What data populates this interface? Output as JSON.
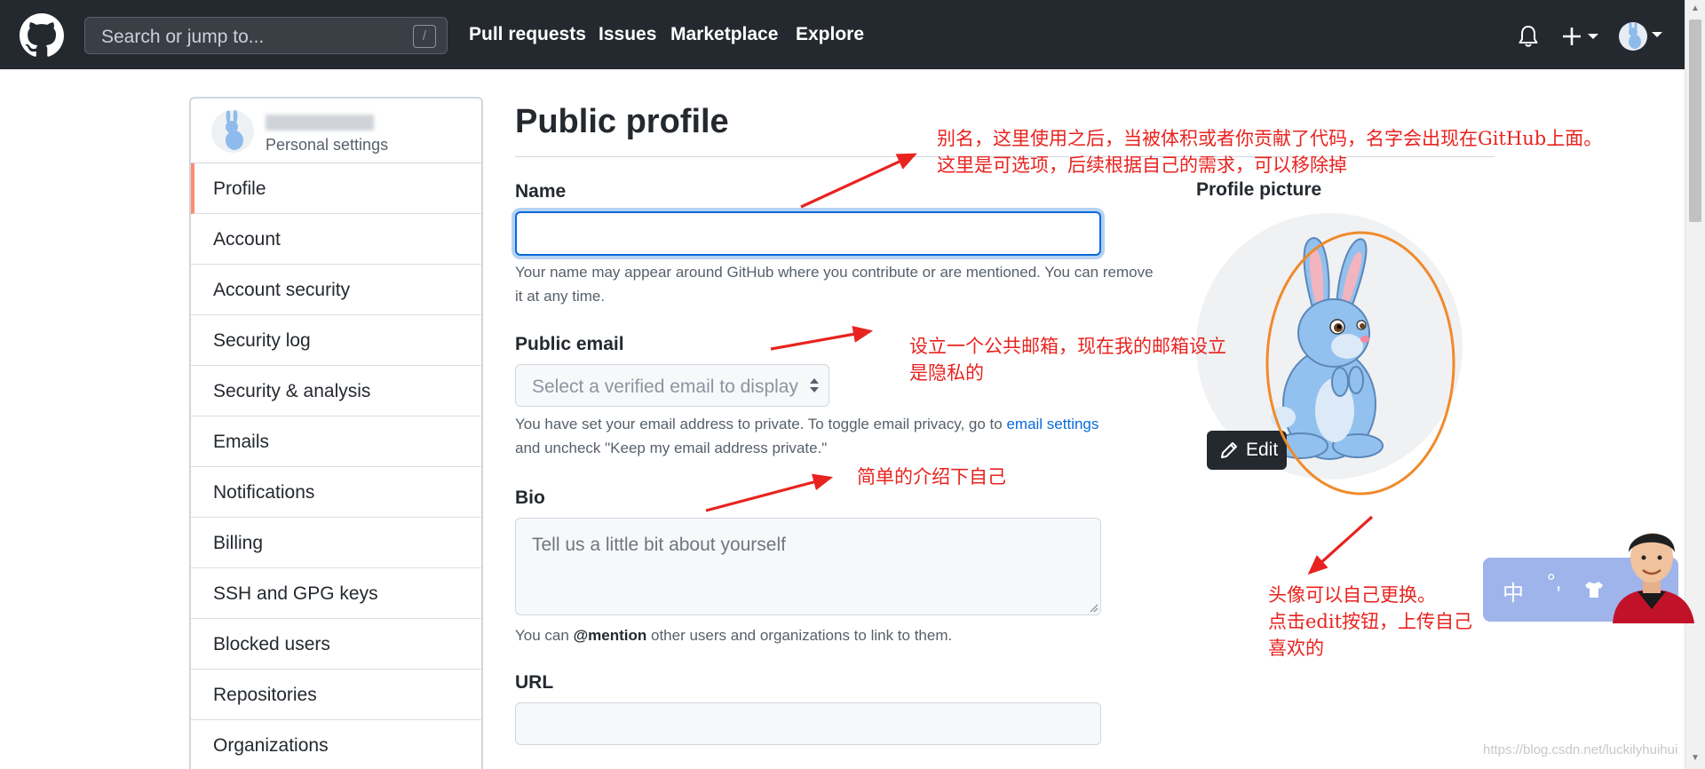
{
  "header": {
    "search_placeholder": "Search or jump to...",
    "search_shortcut": "/",
    "nav": [
      "Pull requests",
      "Issues",
      "Marketplace",
      "Explore"
    ]
  },
  "sidebar": {
    "subtitle": "Personal settings",
    "items": [
      {
        "label": "Profile",
        "active": true
      },
      {
        "label": "Account"
      },
      {
        "label": "Account security"
      },
      {
        "label": "Security log"
      },
      {
        "label": "Security & analysis"
      },
      {
        "label": "Emails"
      },
      {
        "label": "Notifications"
      },
      {
        "label": "Billing"
      },
      {
        "label": "SSH and GPG keys"
      },
      {
        "label": "Blocked users"
      },
      {
        "label": "Repositories"
      },
      {
        "label": "Organizations"
      }
    ]
  },
  "main": {
    "title": "Public profile",
    "name": {
      "label": "Name",
      "value": "",
      "note": "Your name may appear around GitHub where you contribute or are mentioned. You can remove it at any time."
    },
    "email": {
      "label": "Public email",
      "placeholder": "Select a verified email to display",
      "note_before": "You have set your email address to private. To toggle email privacy, go to",
      "note_link": "email settings",
      "note_after": "and uncheck \"Keep my email address private.\""
    },
    "bio": {
      "label": "Bio",
      "placeholder": "Tell us a little bit about yourself",
      "note_before": "You can",
      "note_mention": "@mention",
      "note_after": "other users and organizations to link to them."
    },
    "url": {
      "label": "URL",
      "value": ""
    }
  },
  "profile_picture": {
    "label": "Profile picture",
    "edit_label": "Edit"
  },
  "annotations": {
    "name_line1": "别名，这里使用之后，当被体积或者你贡献了代码，名字会出现在GitHub上面。",
    "name_line2": "这里是可选项，后续根据自己的需求，可以移除掉",
    "email_line1": "设立一个公共邮箱，现在我的邮箱设立",
    "email_line2": "是隐私的",
    "bio": "简单的介绍下自己",
    "avatar_line1": "头像可以自己更换。",
    "avatar_line2": "点击edit按钮，上传自己",
    "avatar_line3": "喜欢的"
  },
  "ime": {
    "mode": "中",
    "punct": "°,"
  },
  "watermark": "https://blog.csdn.net/luckilyhuihui",
  "colors": {
    "header_bg": "#24292f",
    "link": "#0969da",
    "annotation_red": "#e8231f",
    "avatar_oval": "#f08a2a",
    "active_marker": "#fd8c73",
    "focus_ring": "#0969da",
    "ime_bg": "#9fb4ea"
  }
}
